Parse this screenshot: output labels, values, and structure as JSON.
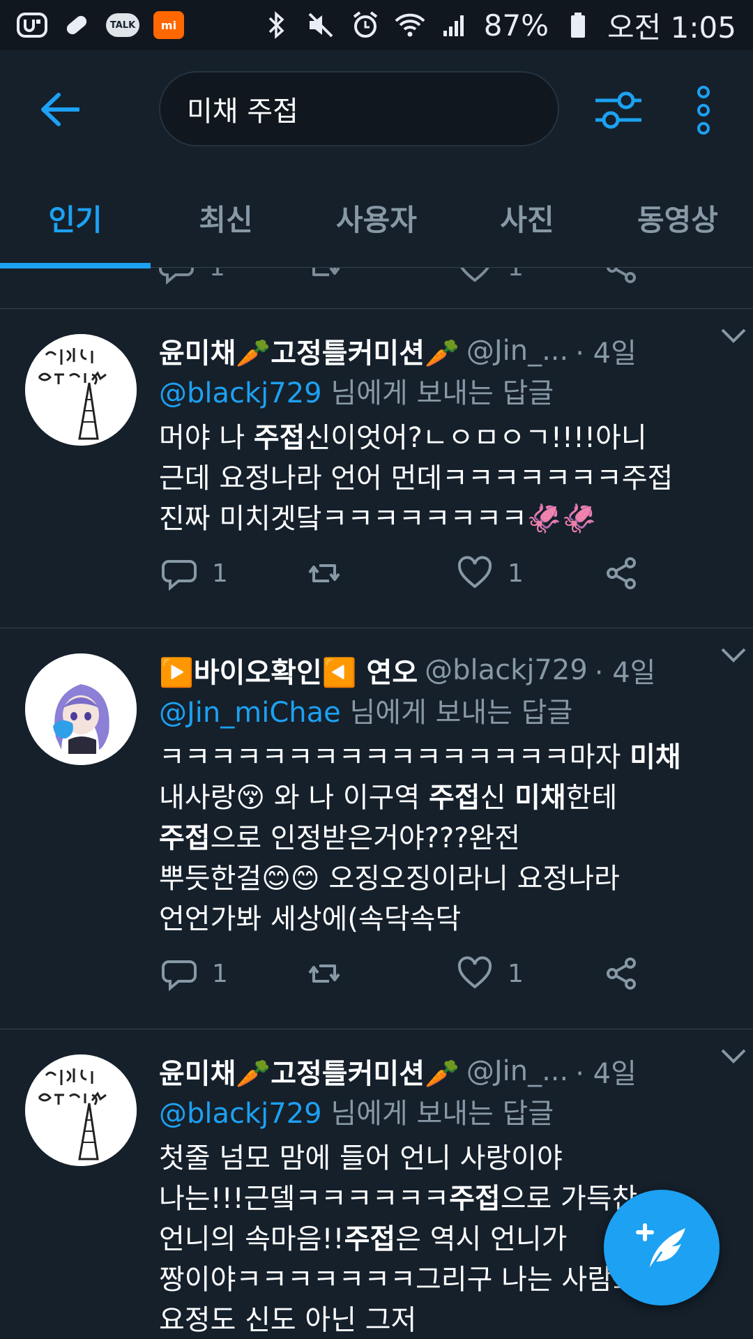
{
  "status_bar": {
    "icons_left": [
      "u-plus-icon",
      "pill-icon",
      "kakaotalk-icon",
      "mi-app-icon"
    ],
    "talk_label": "TALK",
    "mi_label": "mi",
    "icons_right": [
      "bluetooth-icon",
      "mute-icon",
      "alarm-icon",
      "wifi-icon",
      "signal-icon",
      "battery-icon"
    ],
    "battery": "87%",
    "time": "오전 1:05"
  },
  "header": {
    "search_value": "미채 주접"
  },
  "tabs": [
    {
      "label": "인기",
      "active": true
    },
    {
      "label": "최신",
      "active": false
    },
    {
      "label": "사용자",
      "active": false
    },
    {
      "label": "사진",
      "active": false
    },
    {
      "label": "동영상",
      "active": false
    }
  ],
  "previous_tweet": {
    "reply_count": "1",
    "like_count": "1"
  },
  "tweets": [
    {
      "name": "윤미채🥕고정틀커미션🥕",
      "handle": "@Jin_...",
      "time": "· 4일",
      "reply_to_mention": "@blackj729",
      "reply_to_suffix": " 님에게 보내는 답글",
      "body_lines": [
        [
          "머야 나 ",
          "**주접**",
          "신이엇어?ㄴㅇㅁㅇㄱ!!!!아니"
        ],
        [
          "근데 요정나라 언어 먼데ㅋㅋㅋㅋㅋㅋㅋ주접"
        ],
        [
          "진짜 미치겟닼ㅋㅋㅋㅋㅋㅋㅋㅋ🦑🦑"
        ]
      ],
      "reply_count": "1",
      "like_count": "1",
      "avatar": "drawing-avatar"
    },
    {
      "name": "▶️바이오확인◀️ 연오",
      "handle": "@blackj729",
      "time": "· 4일",
      "reply_to_mention": "@Jin_miChae",
      "reply_to_suffix": " 님에게 보내는 답글",
      "body_lines": [
        [
          "ㅋㅋㅋㅋㅋㅋㅋㅋㅋㅋㅋㅋㅋㅋㅋㅋ마자 ",
          "**미채**"
        ],
        [
          "내사랑😚 와 나 이구역 ",
          "**주접**",
          "신 ",
          "**미채**",
          "한테"
        ],
        [
          "**주접**",
          "으로 인정받은거야???완전"
        ],
        [
          "뿌듯한걸😊😊 오징오징이라니 요정나라"
        ],
        [
          "언언가봐 세상에(속닥속닥"
        ]
      ],
      "reply_count": "1",
      "like_count": "1",
      "avatar": "anime-girl-avatar"
    },
    {
      "name": "윤미채🥕고정틀커미션🥕",
      "handle": "@Jin_...",
      "time": "· 4일",
      "reply_to_mention": "@blackj729",
      "reply_to_suffix": " 님에게 보내는 답글",
      "body_lines": [
        [
          "첫줄 넘모 맘에 들어 언니 사랑이야"
        ],
        [
          "나는!!!근뎈ㅋㅋㅋㅋㅋㅋ",
          "**주접**",
          "으로 가득찬"
        ],
        [
          "언니의 속마음!!",
          "**주접**",
          "은 역시 언니가"
        ],
        [
          "짱이야ㅋㅋㅋㅋㅋㅋㅋ그리구 나는 사람도"
        ],
        [
          "요정도 신도 아닌 그저"
        ]
      ],
      "avatar": "drawing-avatar"
    }
  ],
  "fab": {
    "icon": "compose-tweet-icon"
  },
  "colors": {
    "background": "#15202b",
    "accent": "#1da1f2",
    "secondary_text": "#8899a6",
    "divider": "#38444d"
  }
}
